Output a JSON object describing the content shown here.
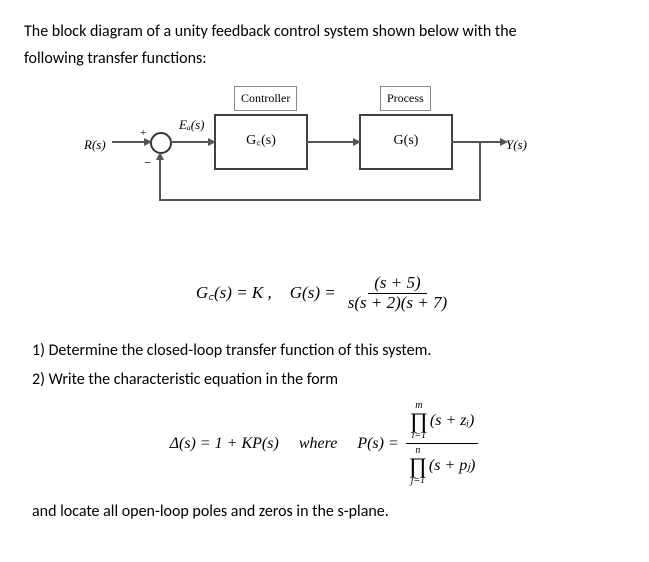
{
  "intro": {
    "line1": "The block diagram of a unity feedback control system shown below with the",
    "line2": "following transfer functions:"
  },
  "diagram": {
    "controller_label": "Controller",
    "process_label": "Process",
    "r_signal": "R(s)",
    "ea_signal": "Eₐ(s)",
    "gc_box": "G꜀(s)",
    "g_box": "G(s)",
    "y_signal": "Y(s)",
    "plus": "+",
    "minus": "−"
  },
  "tf": {
    "gc_def": "G꜀(s) = K ,",
    "g_def_lhs": "G(s) =",
    "g_num": "(s + 5)",
    "g_den": "s(s + 2)(s + 7)"
  },
  "q": {
    "q1": "1)  Determine the closed-loop transfer function of this system.",
    "q2": "2)  Write the characteristic equation in the form"
  },
  "char": {
    "delta_eq": "Δ(s) = 1 + KP(s)",
    "where": "where",
    "p_lhs": "P(s) =",
    "top_lim": "m",
    "top_idx": "i=1",
    "top_term": "(s + zᵢ)",
    "bot_lim": "n",
    "bot_idx": "j=1",
    "bot_term": "(s + pⱼ)"
  },
  "closing": "and locate all open-loop poles and zeros in the s-plane."
}
